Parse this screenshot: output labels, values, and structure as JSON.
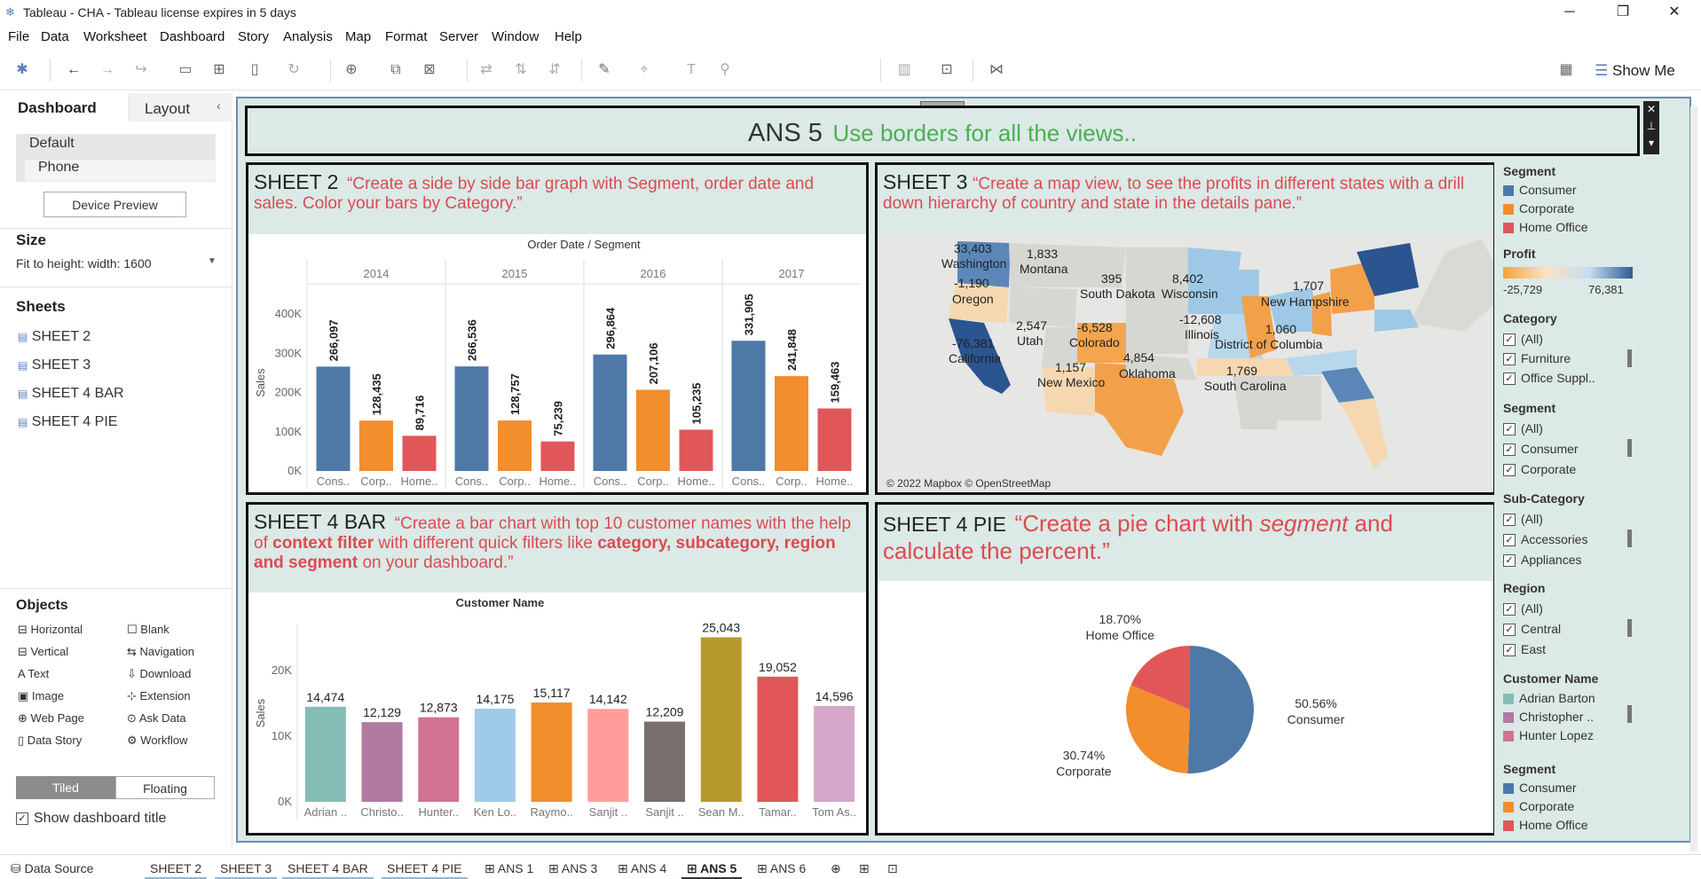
{
  "window": {
    "title": "Tableau - CHA - Tableau license expires in 5 days",
    "minimize": "─",
    "maximize": "❐",
    "close": "✕"
  },
  "menu": [
    "File",
    "Data",
    "Worksheet",
    "Dashboard",
    "Story",
    "Analysis",
    "Map",
    "Format",
    "Server",
    "Window",
    "Help"
  ],
  "toolbar": {
    "show_me": "Show Me"
  },
  "left": {
    "tab_dashboard": "Dashboard",
    "tab_layout": "Layout",
    "devices": [
      "Default",
      "Phone"
    ],
    "device_preview": "Device Preview",
    "size_title": "Size",
    "size_value": "Fit to height: width: 1600",
    "sheets_title": "Sheets",
    "sheets": [
      "SHEET 2",
      "SHEET 3",
      "SHEET 4 BAR",
      "SHEET 4 PIE"
    ],
    "objects_title": "Objects",
    "objects": [
      "Horizontal",
      "Blank",
      "Vertical",
      "Navigation",
      "Text",
      "Download",
      "Image",
      "Extension",
      "Web Page",
      "Ask Data",
      "Data Story",
      "Workflow"
    ],
    "tiled": "Tiled",
    "floating": "Floating",
    "show_title": "Show dashboard title",
    "show_title_check": "✓"
  },
  "dashboard": {
    "title_main": "ANS 5",
    "title_sub": "Use borders for all the views.."
  },
  "sheet2": {
    "name": "SHEET 2",
    "desc": "“Create a side by side bar graph with Segment, order date and sales. Color your bars by Category.”"
  },
  "sheet3": {
    "name": "SHEET 3",
    "desc": "“Create a map view, to see the profits in different states with a drill down hierarchy of country and state in the details pane.”",
    "attribution": "© 2022 Mapbox © OpenStreetMap",
    "labels": [
      "33,403",
      "Washington",
      "-1,190",
      "Oregon",
      "-76,381",
      "California",
      "1,833",
      "Montana",
      "2,547",
      "Utah",
      "-6,528",
      "Colorado",
      "1,157",
      "New Mexico",
      "395",
      "South Dakota",
      "4,854",
      "Oklahoma",
      "8,402",
      "Wisconsin",
      "-12,608",
      "Illinois",
      "1,707",
      "New Hampshire",
      "1,060",
      "District of Columbia",
      "1,769",
      "South Carolina"
    ]
  },
  "sheet4bar": {
    "name": "SHEET 4 BAR",
    "desc_parts": [
      "“Create a bar chart with top 10 customer names with the help of ",
      "context filter",
      " with different quick filters like ",
      "category, subcategory, region and segment",
      "  on your dashboard.”"
    ]
  },
  "sheet4pie": {
    "name": "SHEET 4 PIE",
    "desc_a": "“Create a pie chart with ",
    "desc_b": "segment",
    "desc_c": " and calculate the percent.”"
  },
  "legend": {
    "segment_title": "Segment",
    "segments": [
      "Consumer",
      "Corporate",
      "Home Office"
    ],
    "profit_title": "Profit",
    "profit_min": "-25,729",
    "profit_max": "76,381",
    "category_title": "Category",
    "category_items": [
      "(All)",
      "Furniture",
      "Office Suppl.."
    ],
    "segment2_title": "Segment",
    "segment2_items": [
      "(All)",
      "Consumer",
      "Corporate"
    ],
    "subcat_title": "Sub-Category",
    "subcat_items": [
      "(All)",
      "Accessories",
      "Appliances"
    ],
    "region_title": "Region",
    "region_items": [
      "(All)",
      "Central",
      "East"
    ],
    "cust_title": "Customer Name",
    "cust_items": [
      "Adrian Barton",
      "Christopher ..",
      "Hunter Lopez"
    ],
    "segment3_title": "Segment",
    "segment3_items": [
      "Consumer",
      "Corporate",
      "Home Office"
    ],
    "check": "✓"
  },
  "colors": {
    "consumer": "#4e79a7",
    "corporate": "#f28e2b",
    "home_office": "#e15759",
    "accent": "#dc4b50",
    "canvas_bg": "#dbe9e7",
    "green_text": "#4caf50"
  },
  "status": {
    "data_source": "Data Source",
    "tabs": [
      "SHEET 2",
      "SHEET 3",
      "SHEET 4 BAR",
      "SHEET 4 PIE",
      "ANS 1",
      "ANS 3",
      "ANS 4",
      "ANS 5",
      "ANS 6"
    ]
  },
  "chart_data": [
    {
      "type": "bar",
      "title": "Order Date / Segment",
      "ylabel": "Sales",
      "ylim": [
        0,
        450000
      ],
      "yticks": [
        "0K",
        "100K",
        "200K",
        "300K",
        "400K"
      ],
      "groups": [
        "2014",
        "2015",
        "2016",
        "2017"
      ],
      "categories": [
        "Cons..",
        "Corp..",
        "Home.."
      ],
      "series": [
        {
          "name": "Consumer",
          "values": [
            266097,
            266536,
            296864,
            331905
          ]
        },
        {
          "name": "Corporate",
          "values": [
            128435,
            128757,
            207106,
            241848
          ]
        },
        {
          "name": "Home Office",
          "values": [
            89716,
            75239,
            105235,
            159463
          ]
        }
      ],
      "labels": [
        [
          "266,097",
          "128,435",
          "89,716"
        ],
        [
          "266,536",
          "128,757",
          "75,239"
        ],
        [
          "296,864",
          "207,106",
          "105,235"
        ],
        [
          "331,905",
          "241,848",
          "159,463"
        ]
      ]
    },
    {
      "type": "bar",
      "title": "Customer Name",
      "ylabel": "Sales",
      "ylim": [
        0,
        27000
      ],
      "yticks": [
        "0K",
        "10K",
        "20K"
      ],
      "categories": [
        "Adrian ..",
        "Christo..",
        "Hunter..",
        "Ken Lo..",
        "Raymo..",
        "Sanjit ..",
        "Sanjit ..",
        "Sean M..",
        "Tamar..",
        "Tom As.."
      ],
      "values": [
        14474,
        12129,
        12873,
        14175,
        15117,
        14142,
        12209,
        25043,
        19052,
        14596
      ],
      "labels": [
        "14,474",
        "12,129",
        "12,873",
        "14,175",
        "15,117",
        "14,142",
        "12,209",
        "25,043",
        "19,052",
        "14,596"
      ],
      "colors": [
        "#86bcb6",
        "#b07aa1",
        "#d37295",
        "#a0cbe8",
        "#f28e2b",
        "#ff9d9a",
        "#79706e",
        "#b6992d",
        "#e15759",
        "#d4a6c8"
      ]
    },
    {
      "type": "pie",
      "slices": [
        {
          "name": "Consumer",
          "value": 50.56,
          "label": "50.56%"
        },
        {
          "name": "Corporate",
          "value": 30.74,
          "label": "30.74%"
        },
        {
          "name": "Home Office",
          "value": 18.7,
          "label": "18.70%"
        }
      ]
    }
  ]
}
